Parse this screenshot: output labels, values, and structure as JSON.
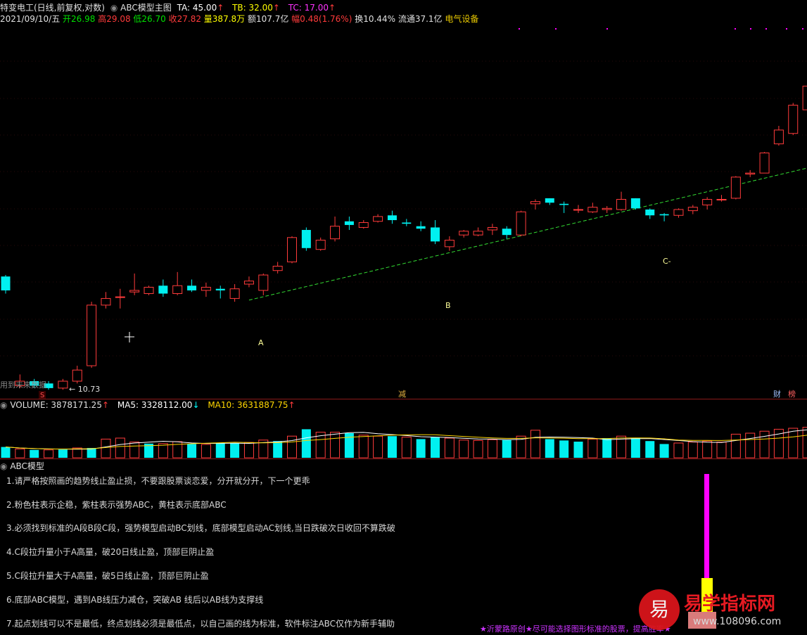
{
  "info": {
    "stock_title": "特变电工(日线,前复权,对数)",
    "indicator_name": "ABC模型主图",
    "ta": "TA: 45.00",
    "tb": "TB: 32.00",
    "tc": "TC: 17.00",
    "up_arrow": "↑",
    "date": "2021/09/10/五",
    "open": "开26.98",
    "high": "高29.08",
    "low": "低26.70",
    "close": "收27.82",
    "volume": "量387.8万",
    "amount": "额107.7亿",
    "change": "幅0.48(1.76%)",
    "turnover": "换10.44%",
    "float_cap": "流通37.1亿",
    "sector": "电气设备"
  },
  "main_chart": {
    "label_a": "A",
    "label_b": "B",
    "label_c": "C-",
    "price_low_label": "← 10.73",
    "future_data": "用到未来数据",
    "marker_s": "S",
    "marker_jian": "减",
    "marker_cai": "财",
    "marker_bang": "榜"
  },
  "volume_pane": {
    "title": "VOLUME: 3878171.25",
    "ma5": "MA5: 3328112.00",
    "ma10": "MA10: 3631887.75",
    "down_arrow": "↓",
    "up_arrow": "↑"
  },
  "abc_pane": {
    "title": "ABC模型",
    "notes": [
      "1.请严格按照画的趋势线止盈止损，不要跟股票谈恋爱，分开就分开，下一个更乖",
      "2.粉色柱表示企稳，紫柱表示强势ABC，黄柱表示底部ABC",
      "3.必须找到标准的A段B段C段，强势模型启动BC划线，底部模型启动AC划线,当日跌破次日收回不算跌破",
      "4.C段拉升量小于A高量，破20日线止盈，顶部巨阴止盈",
      "5.C段拉升量大于A高量，破5日线止盈，顶部巨阴止盈",
      "6.底部ABC模型，遇到AB线压力减仓，突破AB 线后以AB线为支撑线",
      "7.起点划线可以不是最低，终点划线必须是最低点，以自己画的线为标准，软件标注ABC仅作为新手辅助"
    ],
    "footer_text": "★沂蒙路原创★尽可能选择图形标准的股票，提高胜率★"
  },
  "watermark": {
    "icon_char": "易",
    "brand": "易学指标网",
    "url": "www.108096.com"
  },
  "colors": {
    "up": "#ff3b3b",
    "down": "#00f0f0",
    "ma5": "#ffffff",
    "ma10": "#ffd700",
    "trend": "#33dd33",
    "magenta": "#ff00ff",
    "yellow": "#ffff00"
  },
  "chart_data": {
    "type": "candlestick",
    "price_scale": "log",
    "candles": [
      {
        "o": 16.8,
        "c": 15.9,
        "h": 16.9,
        "l": 15.7
      },
      {
        "o": 10.9,
        "c": 11.1,
        "h": 11.4,
        "l": 10.8
      },
      {
        "o": 11.1,
        "c": 10.9,
        "h": 11.2,
        "l": 10.8
      },
      {
        "o": 11.0,
        "c": 10.8,
        "h": 11.1,
        "l": 10.73
      },
      {
        "o": 10.8,
        "c": 11.1,
        "h": 11.2,
        "l": 10.73
      },
      {
        "o": 11.1,
        "c": 11.6,
        "h": 11.8,
        "l": 11.0
      },
      {
        "o": 11.8,
        "c": 15.0,
        "h": 15.2,
        "l": 11.7
      },
      {
        "o": 15.0,
        "c": 15.4,
        "h": 15.8,
        "l": 14.8
      },
      {
        "o": 15.5,
        "c": 15.5,
        "h": 16.0,
        "l": 14.8
      },
      {
        "o": 15.8,
        "c": 15.9,
        "h": 17.0,
        "l": 15.6
      },
      {
        "o": 15.7,
        "c": 16.1,
        "h": 16.2,
        "l": 15.6
      },
      {
        "o": 16.2,
        "c": 15.7,
        "h": 16.6,
        "l": 15.5
      },
      {
        "o": 15.7,
        "c": 16.2,
        "h": 17.1,
        "l": 15.6
      },
      {
        "o": 16.2,
        "c": 15.9,
        "h": 16.6,
        "l": 15.8
      },
      {
        "o": 15.9,
        "c": 16.1,
        "h": 16.4,
        "l": 15.5
      },
      {
        "o": 16.0,
        "c": 15.9,
        "h": 16.2,
        "l": 15.4
      },
      {
        "o": 15.4,
        "c": 16.0,
        "h": 16.3,
        "l": 15.2
      },
      {
        "o": 16.3,
        "c": 16.5,
        "h": 16.8,
        "l": 16.1
      },
      {
        "o": 15.9,
        "c": 16.9,
        "h": 17.0,
        "l": 15.6
      },
      {
        "o": 17.2,
        "c": 17.5,
        "h": 17.8,
        "l": 17.0
      },
      {
        "o": 17.8,
        "c": 19.6,
        "h": 19.7,
        "l": 17.7
      },
      {
        "o": 20.2,
        "c": 18.8,
        "h": 20.4,
        "l": 18.6
      },
      {
        "o": 18.7,
        "c": 19.4,
        "h": 19.6,
        "l": 18.6
      },
      {
        "o": 19.5,
        "c": 20.5,
        "h": 21.3,
        "l": 19.3
      },
      {
        "o": 20.9,
        "c": 20.6,
        "h": 21.3,
        "l": 20.2
      },
      {
        "o": 20.4,
        "c": 20.8,
        "h": 21.0,
        "l": 20.3
      },
      {
        "o": 20.9,
        "c": 21.3,
        "h": 21.5,
        "l": 20.8
      },
      {
        "o": 21.4,
        "c": 21.0,
        "h": 21.8,
        "l": 20.7
      },
      {
        "o": 20.8,
        "c": 20.7,
        "h": 21.1,
        "l": 20.5
      },
      {
        "o": 20.5,
        "c": 20.3,
        "h": 20.9,
        "l": 20.1
      },
      {
        "o": 20.4,
        "c": 19.3,
        "h": 21.0,
        "l": 19.1
      },
      {
        "o": 18.9,
        "c": 19.4,
        "h": 19.7,
        "l": 18.6
      },
      {
        "o": 19.8,
        "c": 20.1,
        "h": 20.2,
        "l": 19.6
      },
      {
        "o": 19.8,
        "c": 20.1,
        "h": 20.4,
        "l": 19.7
      },
      {
        "o": 20.2,
        "c": 20.4,
        "h": 20.7,
        "l": 19.8
      },
      {
        "o": 20.3,
        "c": 19.8,
        "h": 20.5,
        "l": 19.5
      },
      {
        "o": 19.8,
        "c": 21.7,
        "h": 21.8,
        "l": 19.7
      },
      {
        "o": 22.4,
        "c": 22.6,
        "h": 22.8,
        "l": 21.9
      },
      {
        "o": 22.9,
        "c": 22.5,
        "h": 22.9,
        "l": 22.3
      },
      {
        "o": 22.4,
        "c": 22.3,
        "h": 22.6,
        "l": 21.6
      },
      {
        "o": 21.9,
        "c": 21.9,
        "h": 22.3,
        "l": 21.6
      },
      {
        "o": 21.7,
        "c": 22.1,
        "h": 22.5,
        "l": 21.6
      },
      {
        "o": 21.9,
        "c": 22.0,
        "h": 22.2,
        "l": 21.6
      },
      {
        "o": 21.9,
        "c": 22.8,
        "h": 23.5,
        "l": 21.8
      },
      {
        "o": 22.9,
        "c": 22.0,
        "h": 22.9,
        "l": 21.9
      },
      {
        "o": 21.9,
        "c": 21.4,
        "h": 22.0,
        "l": 21.1
      },
      {
        "o": 21.5,
        "c": 21.4,
        "h": 21.6,
        "l": 20.9
      },
      {
        "o": 21.4,
        "c": 21.9,
        "h": 22.0,
        "l": 21.2
      },
      {
        "o": 21.8,
        "c": 22.1,
        "h": 22.3,
        "l": 21.5
      },
      {
        "o": 22.3,
        "c": 22.8,
        "h": 23.0,
        "l": 21.9
      },
      {
        "o": 22.8,
        "c": 22.8,
        "h": 23.2,
        "l": 22.6
      },
      {
        "o": 22.9,
        "c": 24.9,
        "h": 25.0,
        "l": 22.8
      },
      {
        "o": 25.2,
        "c": 25.3,
        "h": 25.6,
        "l": 24.9
      },
      {
        "o": 25.3,
        "c": 27.4,
        "h": 27.5,
        "l": 25.3
      },
      {
        "o": 28.4,
        "c": 30.0,
        "h": 30.5,
        "l": 28.2
      },
      {
        "o": 29.6,
        "c": 33.1,
        "h": 33.4,
        "l": 29.4
      },
      {
        "o": 32.5,
        "c": 35.7,
        "h": 35.7,
        "l": 32.3
      },
      {
        "o": 36.9,
        "c": 36.0,
        "h": 37.3,
        "l": 35.0
      }
    ],
    "volume_bars": [
      {
        "v": 0.55,
        "up": false
      },
      {
        "v": 0.45,
        "up": true
      },
      {
        "v": 0.4,
        "up": false
      },
      {
        "v": 0.4,
        "up": true
      },
      {
        "v": 0.42,
        "up": false
      },
      {
        "v": 0.5,
        "up": true
      },
      {
        "v": 0.5,
        "up": false
      },
      {
        "v": 0.95,
        "up": true
      },
      {
        "v": 1.0,
        "up": true
      },
      {
        "v": 0.8,
        "up": true
      },
      {
        "v": 0.72,
        "up": false
      },
      {
        "v": 0.72,
        "up": true
      },
      {
        "v": 0.82,
        "up": true
      },
      {
        "v": 0.7,
        "up": false
      },
      {
        "v": 0.68,
        "up": true
      },
      {
        "v": 0.75,
        "up": false
      },
      {
        "v": 0.75,
        "up": false
      },
      {
        "v": 0.78,
        "up": true
      },
      {
        "v": 0.9,
        "up": true
      },
      {
        "v": 0.85,
        "up": false
      },
      {
        "v": 1.1,
        "up": true
      },
      {
        "v": 1.45,
        "up": false
      },
      {
        "v": 1.3,
        "up": true
      },
      {
        "v": 1.3,
        "up": true
      },
      {
        "v": 1.25,
        "up": false
      },
      {
        "v": 1.15,
        "up": true
      },
      {
        "v": 1.1,
        "up": true
      },
      {
        "v": 1.1,
        "up": false
      },
      {
        "v": 1.05,
        "up": true
      },
      {
        "v": 0.95,
        "up": false
      },
      {
        "v": 1.05,
        "up": false
      },
      {
        "v": 1.0,
        "up": true
      },
      {
        "v": 0.9,
        "up": true
      },
      {
        "v": 0.88,
        "up": true
      },
      {
        "v": 0.92,
        "up": true
      },
      {
        "v": 0.9,
        "up": false
      },
      {
        "v": 1.1,
        "up": true
      },
      {
        "v": 1.4,
        "up": true
      },
      {
        "v": 0.95,
        "up": false
      },
      {
        "v": 0.88,
        "up": false
      },
      {
        "v": 0.82,
        "up": false
      },
      {
        "v": 0.95,
        "up": true
      },
      {
        "v": 1.0,
        "up": false
      },
      {
        "v": 1.1,
        "up": true
      },
      {
        "v": 1.0,
        "up": false
      },
      {
        "v": 0.85,
        "up": false
      },
      {
        "v": 0.7,
        "up": false
      },
      {
        "v": 0.75,
        "up": true
      },
      {
        "v": 0.8,
        "up": true
      },
      {
        "v": 0.85,
        "up": true
      },
      {
        "v": 0.8,
        "up": true
      },
      {
        "v": 1.2,
        "up": true
      },
      {
        "v": 1.25,
        "up": true
      },
      {
        "v": 1.35,
        "up": true
      },
      {
        "v": 1.45,
        "up": true
      },
      {
        "v": 1.5,
        "up": true
      },
      {
        "v": 1.55,
        "up": true
      },
      {
        "v": 2.2,
        "up": false
      }
    ],
    "trendline": [
      {
        "from": 17,
        "to": 57,
        "y0": 15.3,
        "y1": 25.8
      }
    ]
  }
}
